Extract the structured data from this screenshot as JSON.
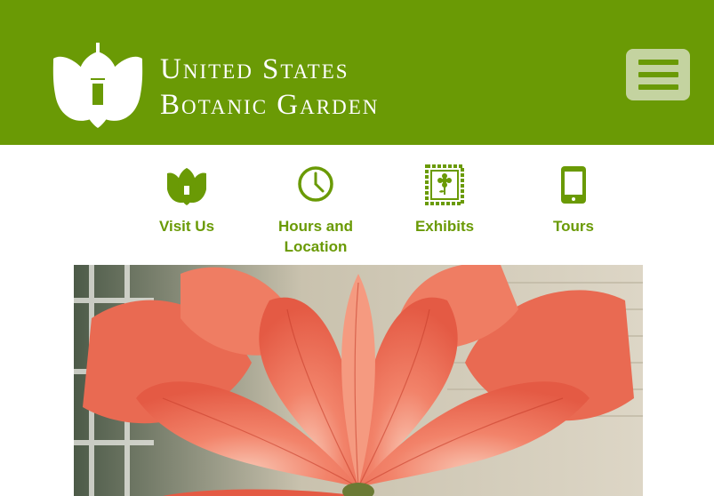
{
  "header": {
    "title_line1": "United States",
    "title_line2": "Botanic Garden",
    "menu_icon": "hamburger-menu-icon",
    "logo_icon": "botanic-garden-tulip-logo"
  },
  "nav": {
    "items": [
      {
        "label": "Visit Us",
        "icon": "tulip-icon"
      },
      {
        "label": "Hours and Location",
        "icon": "clock-icon"
      },
      {
        "label": "Exhibits",
        "icon": "framed-flower-icon"
      },
      {
        "label": "Tours",
        "icon": "mobile-phone-icon"
      }
    ]
  },
  "hero": {
    "subject": "amaryllis-flower-photo"
  },
  "colors": {
    "brand_green": "#6a9a05",
    "menu_button_bg": "#c4d3a0",
    "flower_coral": "#f07a5f"
  }
}
